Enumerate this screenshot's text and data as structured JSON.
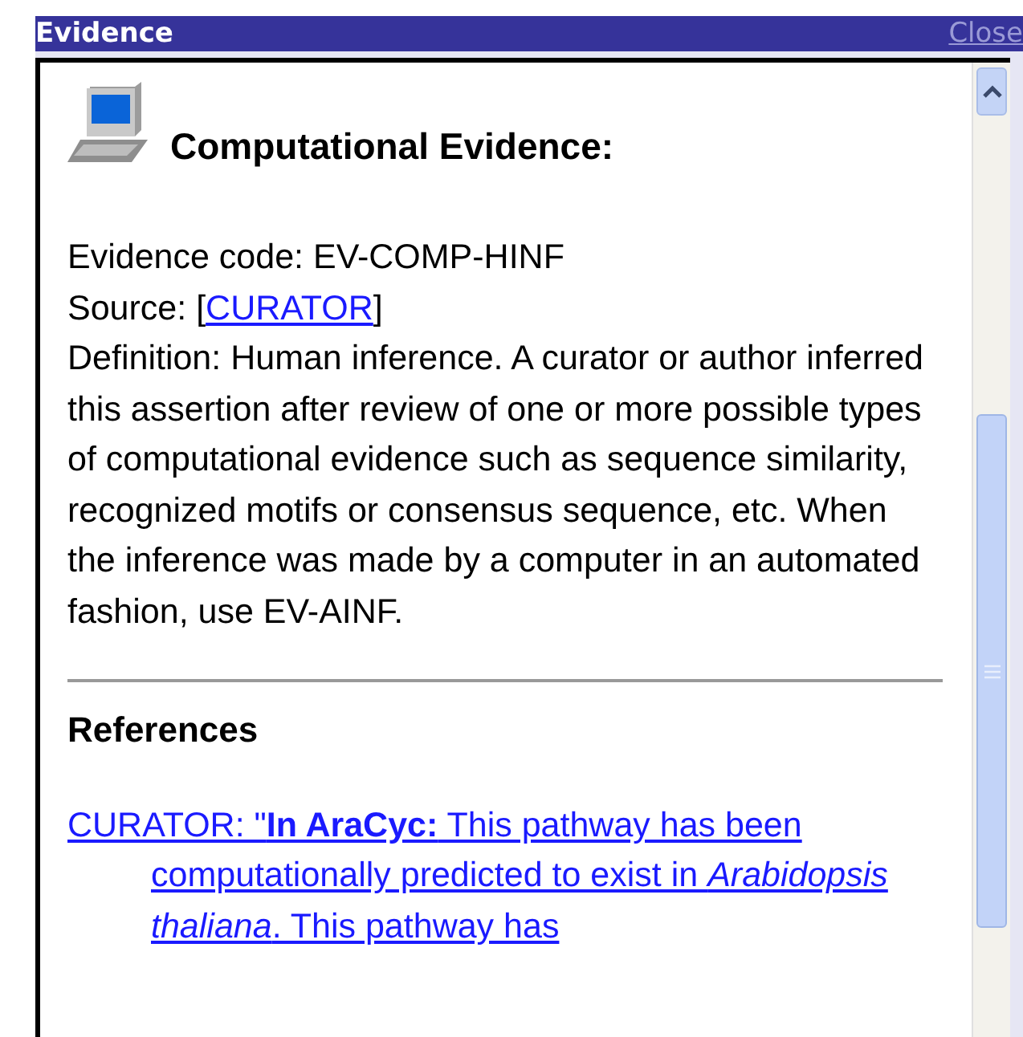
{
  "window": {
    "title": "Evidence",
    "close_label": "Close"
  },
  "heading": "Computational Evidence:",
  "evidence_code": "Evidence code: EV-COMP-HINF",
  "source": {
    "prefix": "Source: [",
    "link": "CURATOR",
    "suffix": "]"
  },
  "definition": "Definition: Human inference. A curator or author inferred this assertion after review of one or more possible types of computational evidence such as sequence similarity, recognized motifs or consensus sequence, etc. When the inference was made by a computer in an automated fashion, use EV-AINF.",
  "references_heading": "References",
  "references": [
    {
      "text": "CURATOR: \"**In AraCyc:** This pathway has been computationally predicted to exist in *Arabidopsis thaliana*. This pathway has"
    }
  ]
}
